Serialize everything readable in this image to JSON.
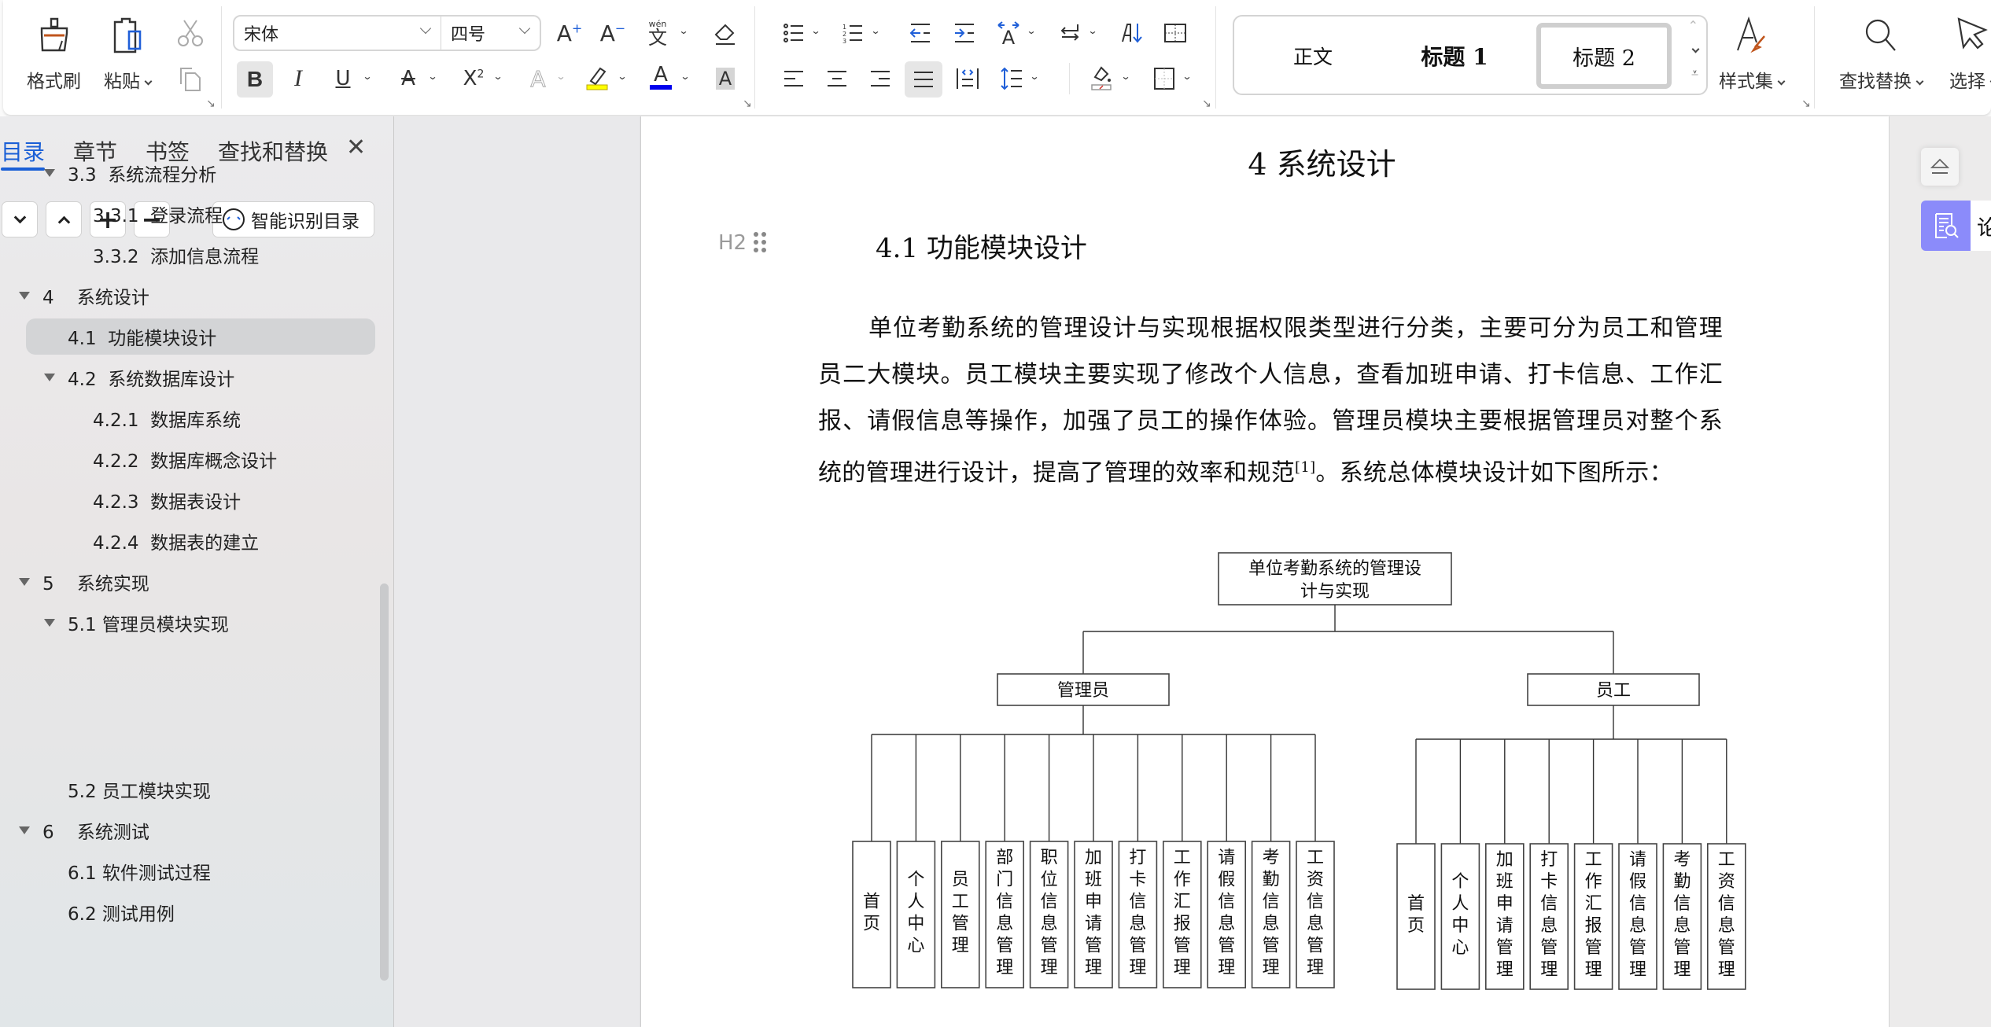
{
  "ribbon": {
    "format_painter": "格式刷",
    "paste": "粘贴",
    "font_name": "宋体",
    "font_size": "四号",
    "style_gallery": [
      "正文",
      "标题  1",
      "标题  2"
    ],
    "selected_style": "标题  2",
    "style_set": "样式集",
    "find_replace": "查找替换",
    "select": "选择",
    "pinyin_glyph": "wén",
    "colors": {
      "highlight": "#ffff00",
      "font_color": "#0000ee",
      "accent": "#1a5fd6"
    }
  },
  "sidebar": {
    "tabs": [
      "目录",
      "章节",
      "书签",
      "查找和替换"
    ],
    "active_tab": "目录",
    "smart_toc_label": "智能识别目录",
    "toc": [
      {
        "label": "3.3  系统流程分析",
        "level": 2,
        "expanded": true
      },
      {
        "label": "3.3.1  登录流程",
        "level": 3
      },
      {
        "label": "3.3.2  添加信息流程",
        "level": 3
      },
      {
        "label": "4    系统设计",
        "level": 1,
        "expanded": true
      },
      {
        "label": "4.1  功能模块设计",
        "level": 2,
        "selected": true
      },
      {
        "label": "4.2  系统数据库设计",
        "level": 2,
        "expanded": true
      },
      {
        "label": "4.2.1  数据库系统",
        "level": 3
      },
      {
        "label": "4.2.2  数据库概念设计",
        "level": 3
      },
      {
        "label": "4.2.3  数据表设计",
        "level": 3
      },
      {
        "label": "4.2.4  数据表的建立",
        "level": 3
      },
      {
        "label": "5    系统实现",
        "level": 1,
        "expanded": true
      },
      {
        "label": "5.1 管理员模块实现",
        "level": 2,
        "expanded": true
      },
      {
        "label": "5.2 员工模块实现",
        "level": 2
      },
      {
        "label": "6    系统测试",
        "level": 1,
        "expanded": true
      },
      {
        "label": "6.1 软件测试过程",
        "level": 2
      },
      {
        "label": "6.2 测试用例",
        "level": 2
      }
    ]
  },
  "document": {
    "chapter_heading": "4   系统设计",
    "section_heading": "4.1  功能模块设计",
    "heading_marker": "H2",
    "paragraph_before_ref": "单位考勤系统的管理设计与实现根据权限类型进行分类，主要可分为员工和管理员二大模块。员工模块主要实现了修改个人信息，查看加班申请、打卡信息、工作汇报、请假信息等操作，加强了员工的操作体验。管理员模块主要根据管理员对整个系统的管理进行设计，提高了管理的效率和规范",
    "citation": "[1]",
    "paragraph_after_ref": "。系统总体模块设计如下图所示：",
    "diagram": {
      "root": "单位考勤系统的管理设计与实现",
      "root_lines": [
        "单位考勤系统的管理设",
        "计与实现"
      ],
      "branches": [
        {
          "name": "管理员",
          "children": [
            "首页",
            "个人中心",
            "员工管理",
            "部门信息管理",
            "职位信息管理",
            "加班申请管理",
            "打卡信息管理",
            "工作汇报管理",
            "请假信息管理",
            "考勤信息管理",
            "工资信息管理"
          ]
        },
        {
          "name": "员工",
          "children": [
            "首页",
            "个人中心",
            "加班申请管理",
            "打卡信息管理",
            "工作汇报管理",
            "请假信息管理",
            "考勤信息管理",
            "工资信息管理"
          ]
        }
      ]
    }
  },
  "right_rail": {
    "review_label": "论"
  }
}
